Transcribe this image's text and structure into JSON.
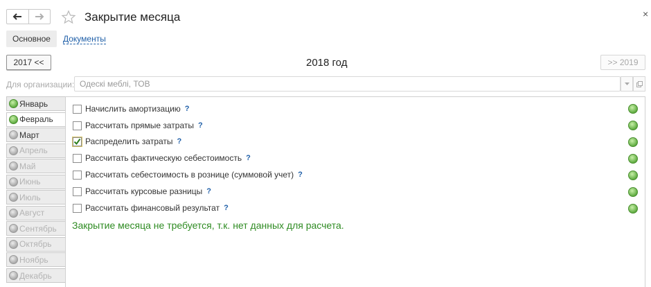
{
  "window": {
    "title": "Закрытие месяца",
    "close_symbol": "×"
  },
  "tabs": [
    {
      "label": "Основное"
    },
    {
      "label": "Документы"
    }
  ],
  "year": {
    "prev_label": "2017 <<",
    "current_label": "2018  год",
    "next_label": ">> 2019"
  },
  "organization": {
    "label": "Для организации:",
    "value": "Одескі меблі, ТОВ"
  },
  "months": [
    {
      "label": "Январь",
      "state": "done"
    },
    {
      "label": "Февраль",
      "state": "done-active"
    },
    {
      "label": "Март",
      "state": "pending"
    },
    {
      "label": "Апрель",
      "state": "disabled"
    },
    {
      "label": "Май",
      "state": "disabled"
    },
    {
      "label": "Июнь",
      "state": "disabled"
    },
    {
      "label": "Июль",
      "state": "disabled"
    },
    {
      "label": "Август",
      "state": "disabled"
    },
    {
      "label": "Сентябрь",
      "state": "disabled"
    },
    {
      "label": "Октябрь",
      "state": "disabled"
    },
    {
      "label": "Ноябрь",
      "state": "disabled"
    },
    {
      "label": "Декабрь",
      "state": "disabled"
    }
  ],
  "operations": [
    {
      "label": "Начислить амортизацию",
      "checked": false,
      "help": "?"
    },
    {
      "label": "Рассчитать прямые затраты",
      "checked": false,
      "help": "?"
    },
    {
      "label": "Распределить затраты",
      "checked": true,
      "help": "?"
    },
    {
      "label": "Рассчитать фактическую себестоимость",
      "checked": false,
      "help": "?"
    },
    {
      "label": "Рассчитать себестоимость в рознице (суммовой учет)",
      "checked": false,
      "help": "?"
    },
    {
      "label": "Рассчитать курсовые разницы",
      "checked": false,
      "help": "?"
    },
    {
      "label": "Рассчитать финансовый результат",
      "checked": false,
      "help": "?"
    }
  ],
  "message": "Закрытие месяца не требуется, т.к. нет данных для расчета.",
  "colors": {
    "accent_link": "#1f5fa8",
    "status_ok": "#5aa83c",
    "message": "#2e8b22"
  },
  "icons": {
    "back": "arrow-left-icon",
    "forward": "arrow-right-icon",
    "favorite": "star-icon",
    "close": "close-icon",
    "dropdown": "chevron-down-icon",
    "open": "open-icon",
    "status": "green-dot-icon"
  }
}
